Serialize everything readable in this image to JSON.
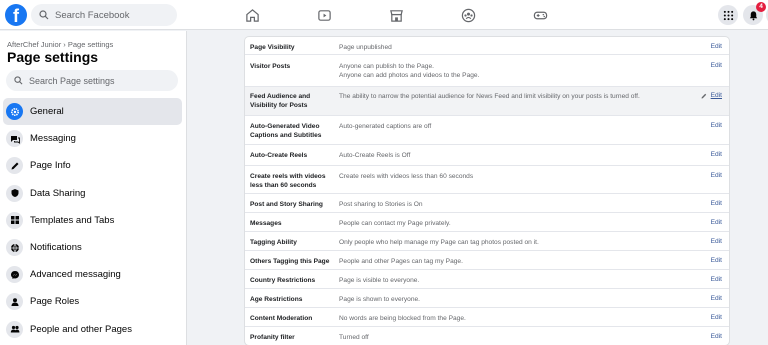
{
  "topbar": {
    "logo": "f",
    "search_placeholder": "Search Facebook",
    "notifications_count": "4",
    "nav_icons": [
      "home-icon",
      "watch-icon",
      "marketplace-icon",
      "groups-icon",
      "gaming-icon"
    ]
  },
  "sidebar": {
    "breadcrumb": "AfterChef Junior › Page settings",
    "title": "Page settings",
    "search_placeholder": "Search Page settings",
    "items": [
      {
        "label": "General",
        "icon": "gear-icon",
        "active": true
      },
      {
        "label": "Messaging",
        "icon": "chat-icon"
      },
      {
        "label": "Page Info",
        "icon": "pencil-icon"
      },
      {
        "label": "Data Sharing",
        "icon": "shield-icon"
      },
      {
        "label": "Templates and Tabs",
        "icon": "grid-icon"
      },
      {
        "label": "Notifications",
        "icon": "globe-icon"
      },
      {
        "label": "Advanced messaging",
        "icon": "messenger-icon"
      },
      {
        "label": "Page Roles",
        "icon": "person-icon"
      },
      {
        "label": "People and other Pages",
        "icon": "people-icon"
      }
    ]
  },
  "settings": {
    "edit_label": "Edit",
    "rows": [
      {
        "label": "Page Visibility",
        "value": "Page unpublished"
      },
      {
        "label": "Visitor Posts",
        "value": "Anyone can publish to the Page.",
        "value2": "Anyone can add photos and videos to the Page."
      },
      {
        "label": "Feed Audience and Visibility for Posts",
        "value": "The ability to narrow the potential audience for News Feed and limit visibility on your posts is turned off."
      },
      {
        "label": "Auto-Generated Video Captions and Subtitles",
        "value": "Auto-generated captions are off"
      },
      {
        "label": "Auto-Create Reels",
        "value": "Auto-Create Reels is Off"
      },
      {
        "label": "Create reels with videos less than 60 seconds",
        "value": "Create reels with videos less than 60 seconds"
      },
      {
        "label": "Post and Story Sharing",
        "value": "Post sharing to Stories is On"
      },
      {
        "label": "Messages",
        "value": "People can contact my Page privately."
      },
      {
        "label": "Tagging Ability",
        "value": "Only people who help manage my Page can tag photos posted on it."
      },
      {
        "label": "Others Tagging this Page",
        "value": "People and other Pages can tag my Page."
      },
      {
        "label": "Country Restrictions",
        "value": "Page is visible to everyone."
      },
      {
        "label": "Age Restrictions",
        "value": "Page is shown to everyone."
      },
      {
        "label": "Content Moderation",
        "value": "No words are being blocked from the Page."
      },
      {
        "label": "Profanity filter",
        "value": "Turned off"
      }
    ]
  }
}
